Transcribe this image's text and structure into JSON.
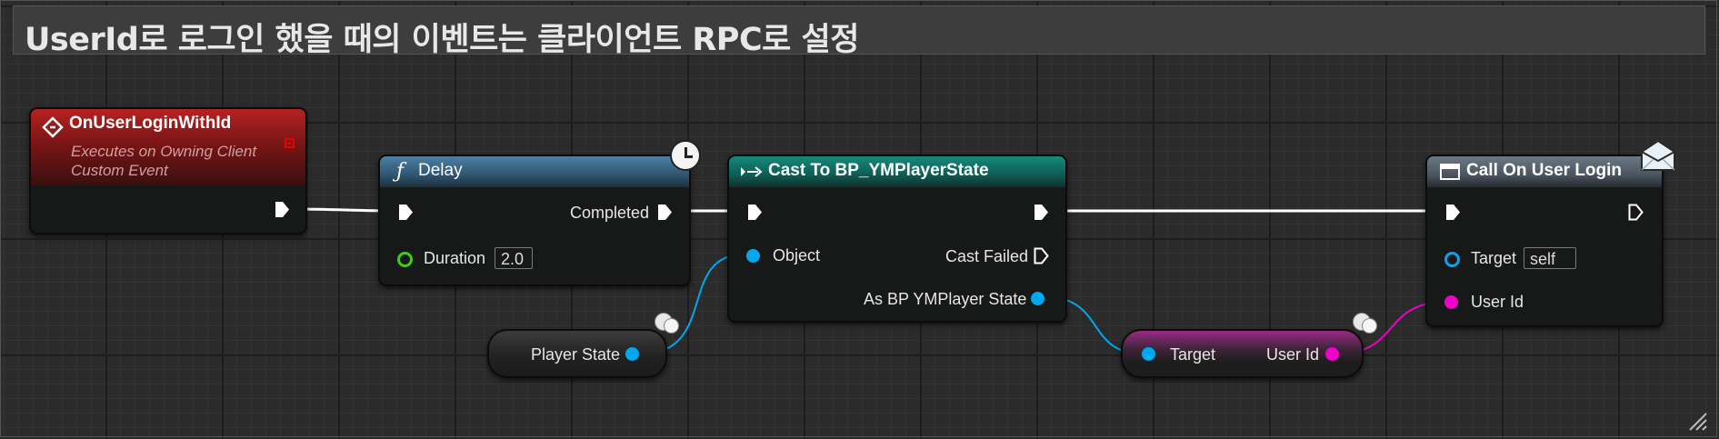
{
  "comment": {
    "title": "UserId로 로그인 했을 때의 이벤트는 클라이언트 RPC로 설정"
  },
  "nodes": {
    "event": {
      "title": "OnUserLoginWithId",
      "subtitle_line1": "Executes on Owning Client",
      "subtitle_line2": "Custom Event",
      "icon": "event-diamond-icon"
    },
    "delay": {
      "title": "Delay",
      "icon": "function-icon",
      "completed_label": "Completed",
      "duration_label": "Duration",
      "duration_value": "2.0",
      "badge_icon": "clock-icon"
    },
    "cast": {
      "title": "Cast To BP_YMPlayerState",
      "icon": "cast-arrows-icon",
      "object_label": "Object",
      "cast_failed_label": "Cast Failed",
      "output_label": "As BP YMPlayer State"
    },
    "player_state": {
      "label": "Player State",
      "badge_icon": "network-cloud-icon"
    },
    "get_userid": {
      "target_label": "Target",
      "output_label": "User Id",
      "badge_icon": "network-cloud-icon"
    },
    "call": {
      "title": "Call On User Login",
      "icon": "function-window-icon",
      "target_label": "Target",
      "target_value": "self",
      "userid_label": "User Id",
      "badge_icon": "envelope-icon"
    }
  },
  "colors": {
    "exec_wire": "#ffffff",
    "object_pin": "#00a8f0",
    "string_pin": "#f000c8",
    "float_pin": "#38d500",
    "event_header": "#8a1a1a",
    "function_header": "#3f6d8e",
    "cast_header": "#0f6e64",
    "call_header": "#5c6873"
  }
}
